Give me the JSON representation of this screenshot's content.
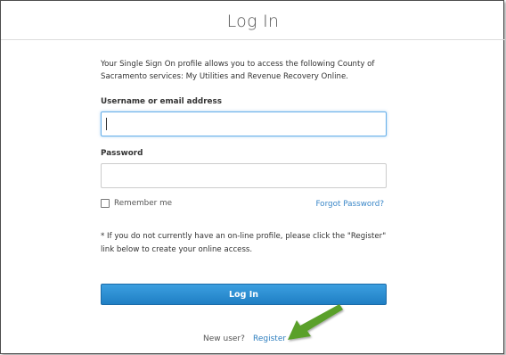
{
  "page": {
    "title": "Log In"
  },
  "intro": {
    "text": "Your Single Sign On profile allows you to access the following County of Sacramento services: My Utilities and Revenue Recovery Online."
  },
  "username": {
    "label": "Username or email address",
    "value": ""
  },
  "password": {
    "label": "Password",
    "value": ""
  },
  "remember": {
    "label": "Remember me",
    "checked": false
  },
  "forgot": {
    "label": "Forgot Password?"
  },
  "note": {
    "text": "* If you do not currently have an on-line profile, please click the \"Register\" link below to create your online access."
  },
  "login_button": {
    "label": "Log In",
    "color": "#2a8fd6"
  },
  "footer": {
    "new_user_text": "New user?",
    "register_label": "Register",
    "arrow_color": "#5aa02c",
    "arrow_icon": "green-arrow-icon"
  }
}
